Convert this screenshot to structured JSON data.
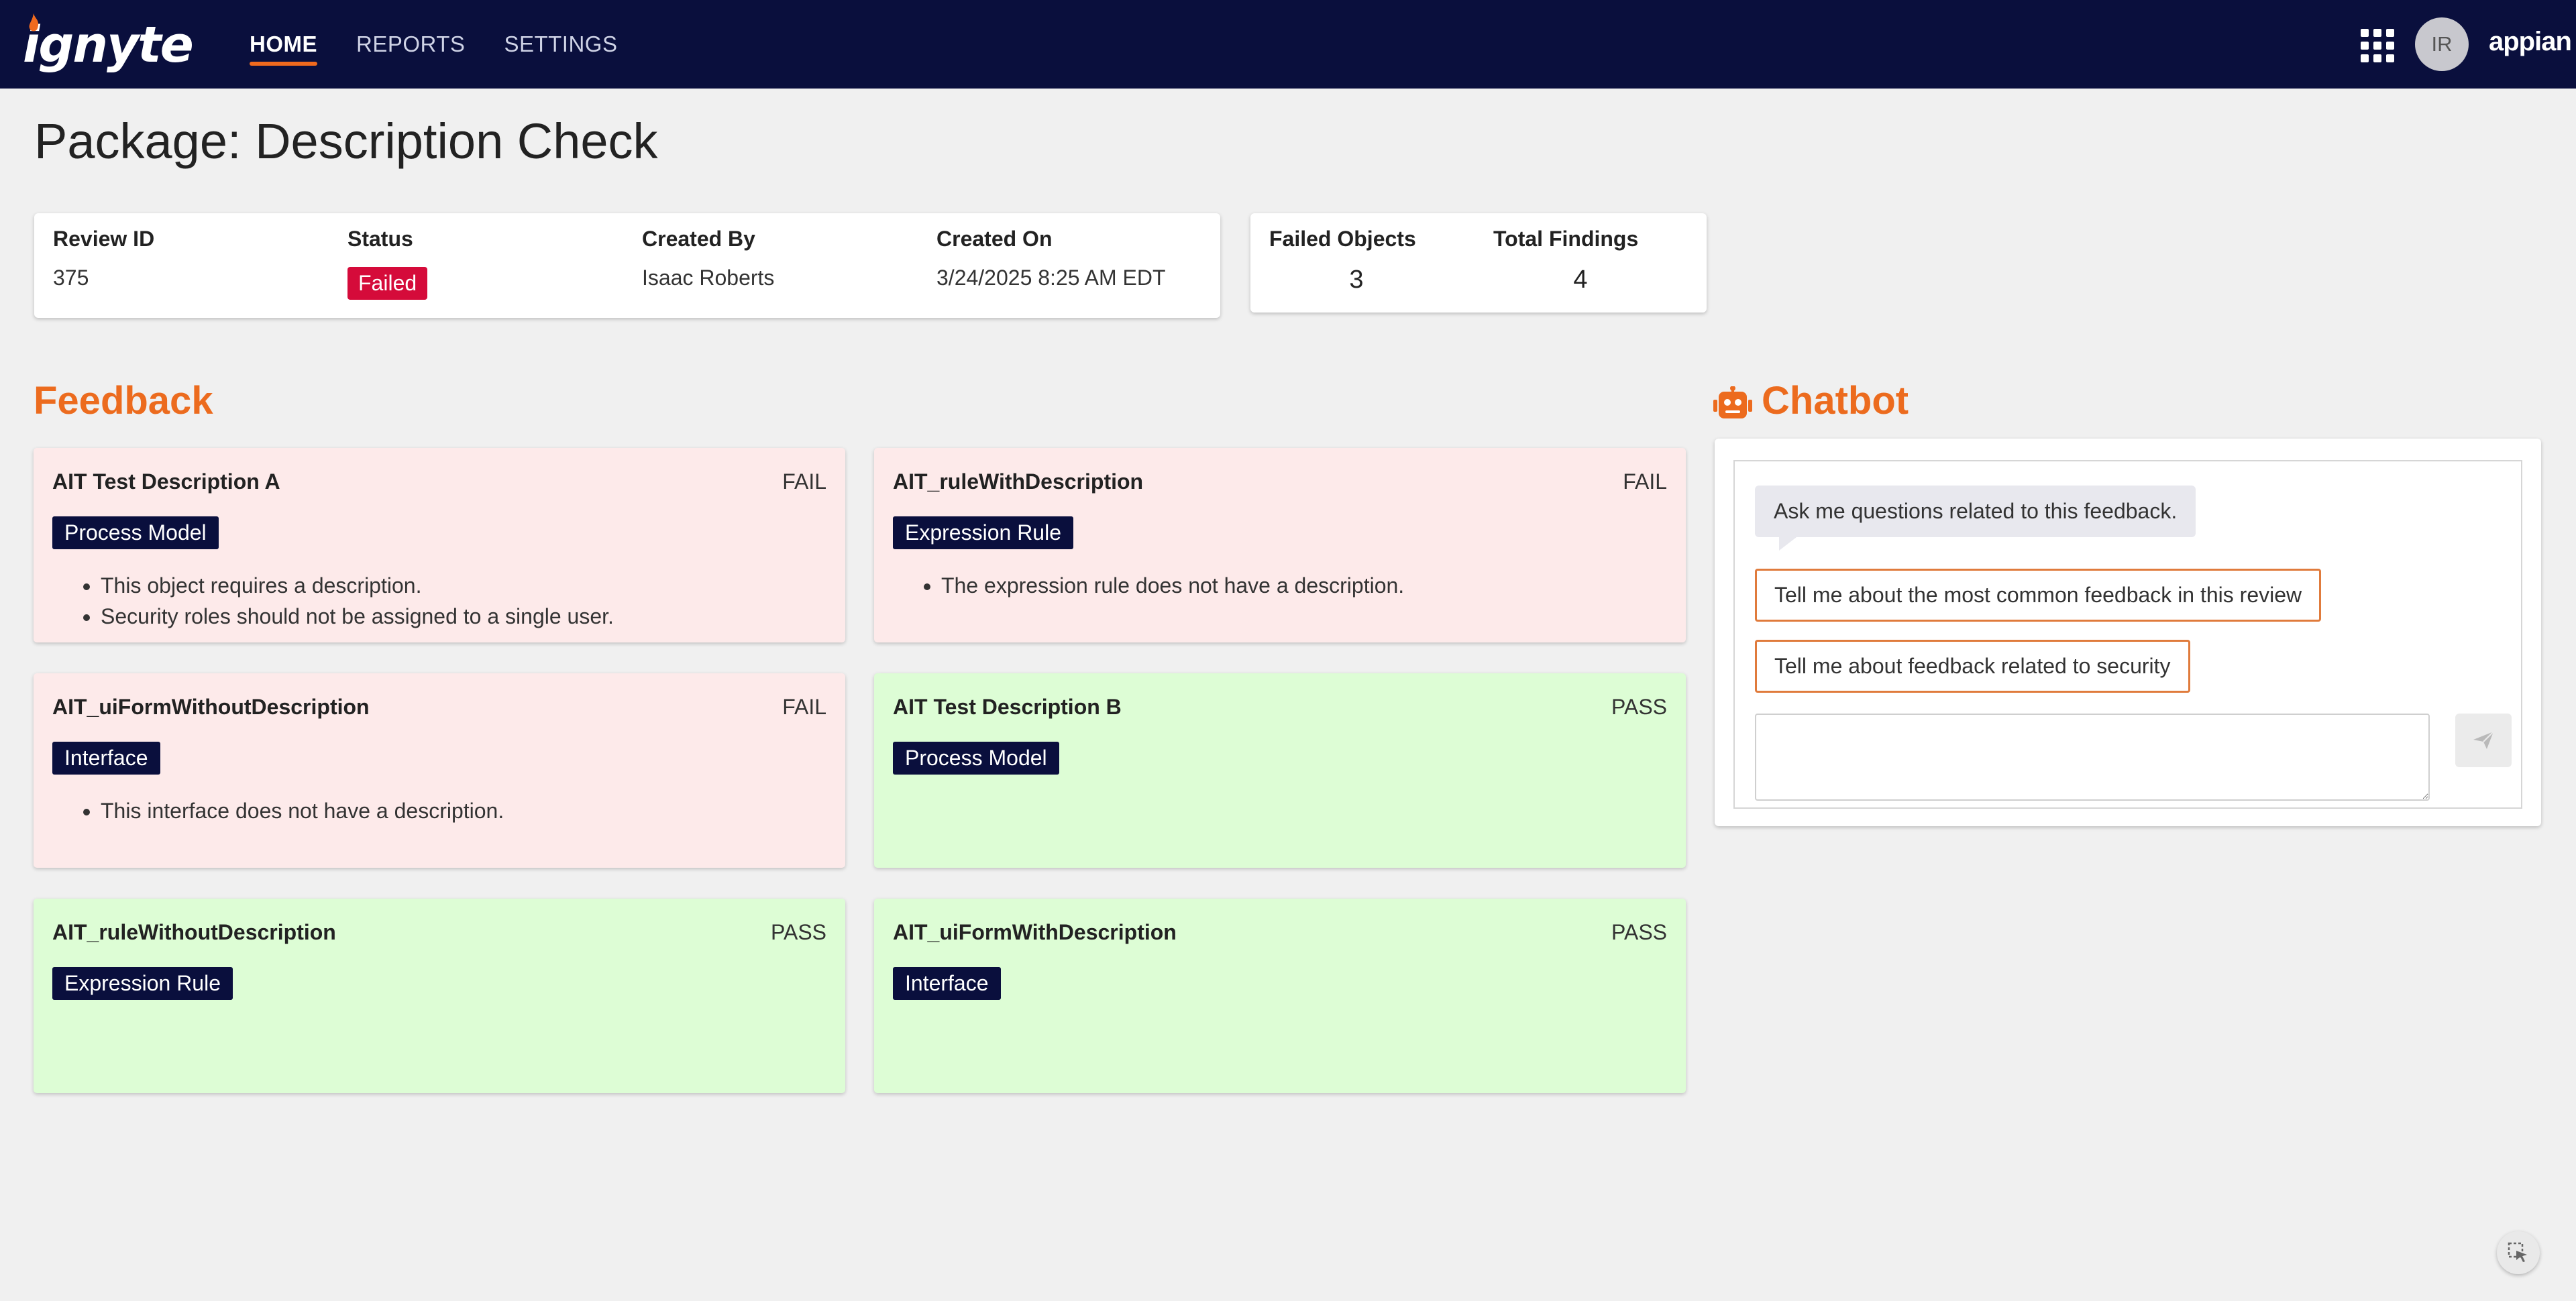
{
  "header": {
    "logo_text": "ignyte",
    "nav": [
      {
        "label": "HOME",
        "active": true
      },
      {
        "label": "REPORTS",
        "active": false
      },
      {
        "label": "SETTINGS",
        "active": false
      }
    ],
    "avatar_initials": "IR",
    "brand": "appian",
    "apps_icon": "grid-icon"
  },
  "page": {
    "title": "Package: Description Check"
  },
  "review": {
    "id_label": "Review ID",
    "id_value": "375",
    "status_label": "Status",
    "status_value": "Failed",
    "created_by_label": "Created By",
    "created_by_value": "Isaac Roberts",
    "created_on_label": "Created On",
    "created_on_value": "3/24/2025 8:25 AM EDT"
  },
  "metrics": {
    "failed_objects_label": "Failed Objects",
    "failed_objects_value": "3",
    "total_findings_label": "Total Findings",
    "total_findings_value": "4"
  },
  "feedback": {
    "heading": "Feedback",
    "items": [
      {
        "name": "AIT Test Description A",
        "result": "FAIL",
        "type": "Process Model",
        "findings": [
          "This object requires a description.",
          "Security roles should not be assigned to a single user."
        ]
      },
      {
        "name": "AIT_ruleWithDescription",
        "result": "FAIL",
        "type": "Expression Rule",
        "findings": [
          "The expression rule does not have a description."
        ]
      },
      {
        "name": "AIT_uiFormWithoutDescription",
        "result": "FAIL",
        "type": "Interface",
        "findings": [
          "This interface does not have a description."
        ]
      },
      {
        "name": "AIT Test Description B",
        "result": "PASS",
        "type": "Process Model",
        "findings": []
      },
      {
        "name": "AIT_ruleWithoutDescription",
        "result": "PASS",
        "type": "Expression Rule",
        "findings": []
      },
      {
        "name": "AIT_uiFormWithDescription",
        "result": "PASS",
        "type": "Interface",
        "findings": []
      }
    ]
  },
  "chatbot": {
    "heading": "Chatbot",
    "icon": "robot-icon",
    "greeting": "Ask me questions related to this feedback.",
    "suggestions": [
      "Tell me about the most common feedback in this review",
      "Tell me about feedback related to security"
    ],
    "input_value": "",
    "send_icon": "send-icon"
  },
  "colors": {
    "header_bg": "#0a0f3d",
    "accent": "#ec6b1e",
    "fail_bg": "#fdeaea",
    "pass_bg": "#ddfdd5",
    "status_failed": "#d50b3a",
    "badge_bg": "#0a0f3d"
  }
}
